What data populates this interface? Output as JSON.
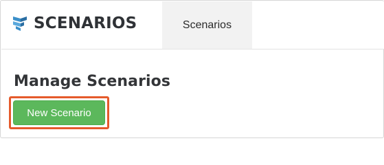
{
  "header": {
    "brand": "SCENARIOS",
    "logo_icon": "stacked-panels-logo-icon",
    "nav_tab_label": "Scenarios"
  },
  "main": {
    "title": "Manage Scenarios",
    "new_button_label": "New Scenario"
  },
  "colors": {
    "accent_green": "#5cb85c",
    "highlight_orange": "#e55a2b",
    "logo_blue": "#3b8fc9",
    "text_dark": "#2f3236"
  }
}
